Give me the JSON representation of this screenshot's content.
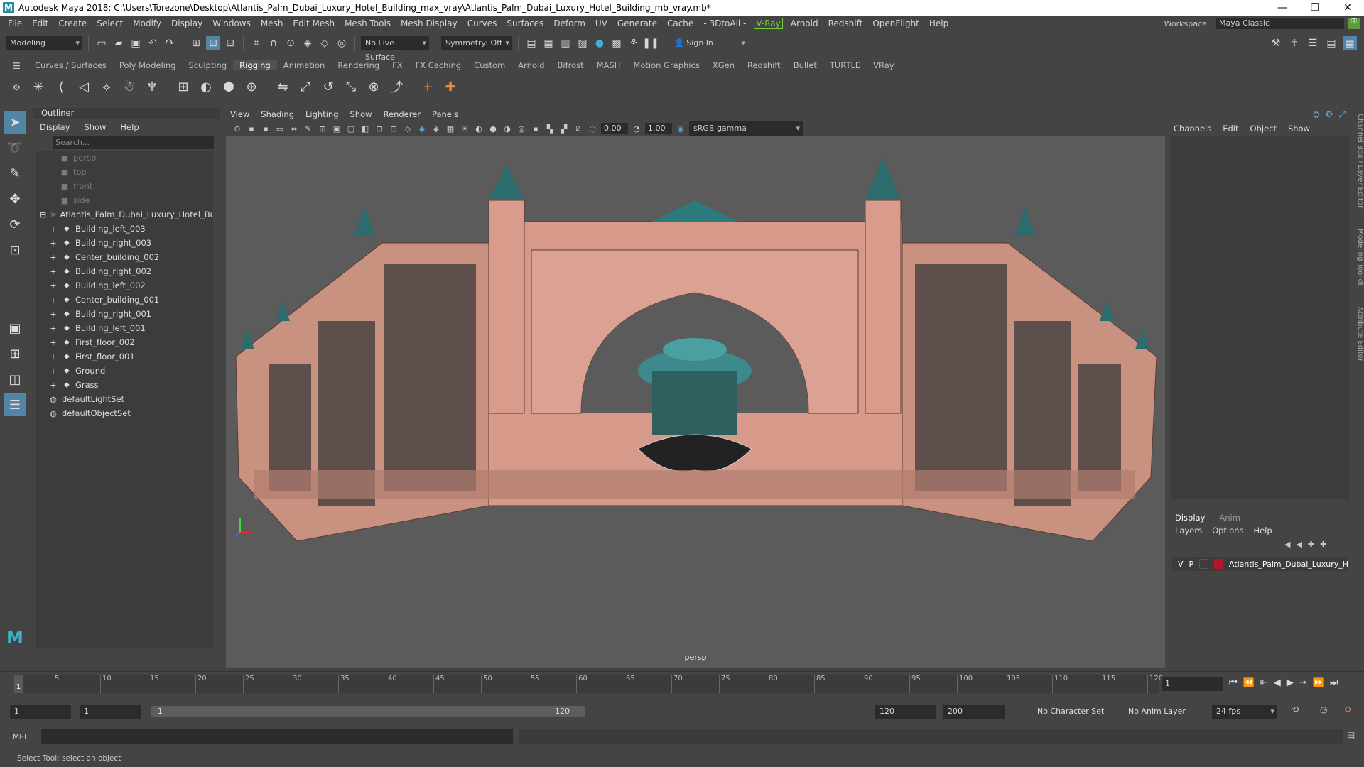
{
  "window": {
    "title": "Autodesk Maya 2018: C:\\Users\\Torezone\\Desktop\\Atlantis_Palm_Dubai_Luxury_Hotel_Building_max_vray\\Atlantis_Palm_Dubai_Luxury_Hotel_Building_mb_vray.mb*",
    "logo": "M"
  },
  "menubar": {
    "items": [
      "File",
      "Edit",
      "Create",
      "Select",
      "Modify",
      "Display",
      "Windows",
      "Mesh",
      "Edit Mesh",
      "Mesh Tools",
      "Mesh Display",
      "Curves",
      "Surfaces",
      "Deform",
      "UV",
      "Generate",
      "Cache",
      "- 3DtoAll -",
      "V-Ray",
      "Arnold",
      "Redshift",
      "OpenFlight",
      "Help"
    ],
    "workspace_label": "Workspace :",
    "workspace_value": "Maya Classic"
  },
  "statusline": {
    "mode": "Modeling",
    "live_surface": "No Live Surface",
    "symmetry": "Symmetry: Off",
    "sign_in": "Sign In"
  },
  "shelf": {
    "tabs": [
      "Curves / Surfaces",
      "Poly Modeling",
      "Sculpting",
      "Rigging",
      "Animation",
      "Rendering",
      "FX",
      "FX Caching",
      "Custom",
      "Arnold",
      "Bifrost",
      "MASH",
      "Motion Graphics",
      "XGen",
      "Redshift",
      "Bullet",
      "TURTLE",
      "VRay"
    ],
    "active_tab": "Rigging"
  },
  "outliner": {
    "title": "Outliner",
    "menu": [
      "Display",
      "Show",
      "Help"
    ],
    "search_placeholder": "Search...",
    "items": [
      {
        "label": "persp",
        "type": "camera"
      },
      {
        "label": "top",
        "type": "camera"
      },
      {
        "label": "front",
        "type": "camera"
      },
      {
        "label": "side",
        "type": "camera"
      },
      {
        "label": "Atlantis_Palm_Dubai_Luxury_Hotel_Bu",
        "type": "group"
      },
      {
        "label": "Building_left_003",
        "type": "mesh"
      },
      {
        "label": "Building_right_003",
        "type": "mesh"
      },
      {
        "label": "Center_building_002",
        "type": "mesh"
      },
      {
        "label": "Building_right_002",
        "type": "mesh"
      },
      {
        "label": "Building_left_002",
        "type": "mesh"
      },
      {
        "label": "Center_building_001",
        "type": "mesh"
      },
      {
        "label": "Building_right_001",
        "type": "mesh"
      },
      {
        "label": "Building_left_001",
        "type": "mesh"
      },
      {
        "label": "First_floor_002",
        "type": "mesh"
      },
      {
        "label": "First_floor_001",
        "type": "mesh"
      },
      {
        "label": "Ground",
        "type": "mesh"
      },
      {
        "label": "Grass",
        "type": "mesh"
      },
      {
        "label": "defaultLightSet",
        "type": "set"
      },
      {
        "label": "defaultObjectSet",
        "type": "set"
      }
    ]
  },
  "viewport": {
    "menu": [
      "View",
      "Shading",
      "Lighting",
      "Show",
      "Renderer",
      "Panels"
    ],
    "exposure": "0.00",
    "gamma": "1.00",
    "color_space": "sRGB gamma",
    "camera_label": "persp"
  },
  "channelbox": {
    "menu": [
      "Channels",
      "Edit",
      "Object",
      "Show"
    ],
    "layer_tabs": [
      "Display",
      "Anim"
    ],
    "layer_menu": [
      "Layers",
      "Options",
      "Help"
    ],
    "layer": {
      "v": "V",
      "p": "P",
      "name": "Atlantis_Palm_Dubai_Luxury_H",
      "color": "#b4162a"
    }
  },
  "sidetabs": [
    "Channel Box / Layer Editor",
    "Modeling Toolkit",
    "Attribute Editor"
  ],
  "timeline": {
    "ticks": [
      "1",
      "5",
      "10",
      "15",
      "20",
      "25",
      "30",
      "35",
      "40",
      "45",
      "50",
      "55",
      "60",
      "65",
      "70",
      "75",
      "80",
      "85",
      "90",
      "95",
      "100",
      "105",
      "110",
      "115",
      "120"
    ],
    "current_frame": "1",
    "frame_field": "1"
  },
  "range": {
    "start": "1",
    "playback_start": "1",
    "slider_start": "1",
    "slider_end": "120",
    "playback_end": "120",
    "end": "200",
    "character_set": "No Character Set",
    "anim_layer": "No Anim Layer",
    "fps": "24 fps"
  },
  "cmdline": {
    "label": "MEL"
  },
  "helpline": {
    "text": "Select Tool: select an object"
  }
}
